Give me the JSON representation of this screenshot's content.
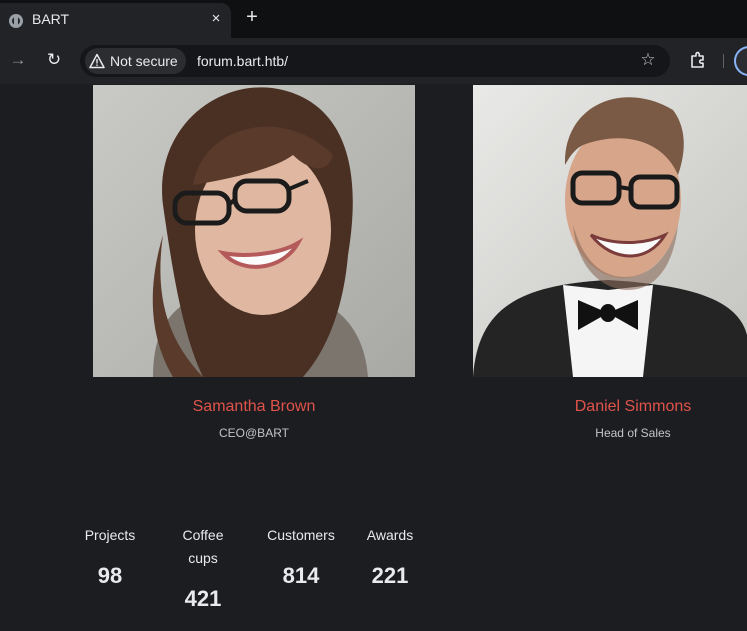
{
  "browser": {
    "tab": {
      "title": "BART",
      "favicon": "globe-icon",
      "close": "×"
    },
    "new_tab": "+",
    "toolbar": {
      "forward": "→",
      "reload": "↻",
      "security_label": "Not secure",
      "url": "forum.bart.htb/",
      "bookmark": "☆"
    }
  },
  "team": [
    {
      "name": "Samantha Brown",
      "role": "CEO@BART"
    },
    {
      "name": "Daniel Simmons",
      "role": "Head of Sales"
    }
  ],
  "stats": [
    {
      "label": "Projects",
      "value": "98"
    },
    {
      "label": "Coffee cups",
      "value": "421"
    },
    {
      "label": "Customers",
      "value": "814"
    },
    {
      "label": "Awards",
      "value": "221"
    }
  ],
  "colors": {
    "accent": "#e0534a",
    "page_background": "#1c1d21",
    "toolbar_background": "#222327"
  }
}
